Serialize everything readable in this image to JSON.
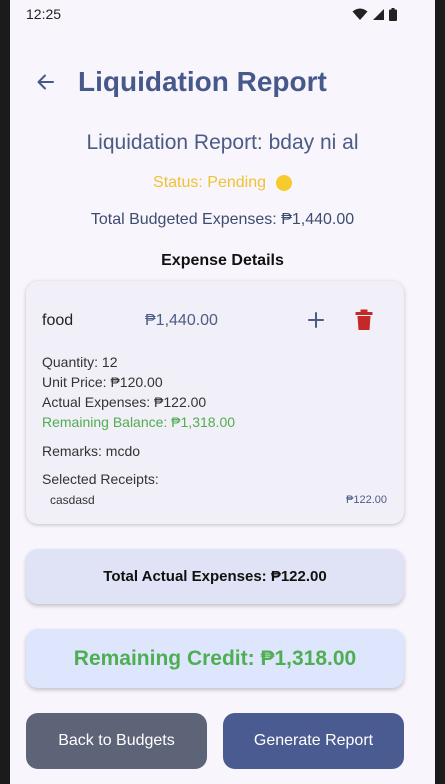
{
  "statusbar": {
    "time": "12:25"
  },
  "appbar": {
    "title": "Liquidation Report"
  },
  "report": {
    "title": "Liquidation Report: bday ni al",
    "status": "Status: Pending",
    "status_color": "#f7cb2d",
    "total_budgeted": "Total Budgeted Expenses: ₱1,440.00"
  },
  "expense_section": {
    "title": "Expense Details"
  },
  "expense": {
    "name": "food",
    "amount": "₱1,440.00",
    "quantity": "Quantity: 12",
    "unit_price": "Unit Price: ₱120.00",
    "actual_expenses": "Actual Expenses: ₱122.00",
    "remaining_balance": "Remaining Balance: ₱1,318.00",
    "remarks": "Remarks: mcdo",
    "selected_receipts_label": "Selected Receipts:",
    "receipts": [
      {
        "name": "casdasd",
        "amount": "₱122.00"
      }
    ]
  },
  "summary": {
    "total_actual": "Total Actual Expenses: ₱122.00",
    "remaining_credit": "Remaining Credit: ₱1,318.00"
  },
  "buttons": {
    "back": "Back to Budgets",
    "generate": "Generate Report"
  },
  "colors": {
    "accent": "#46598a",
    "positive": "#4fae52",
    "delete": "#c62828",
    "pending": "#f7cb2d"
  }
}
